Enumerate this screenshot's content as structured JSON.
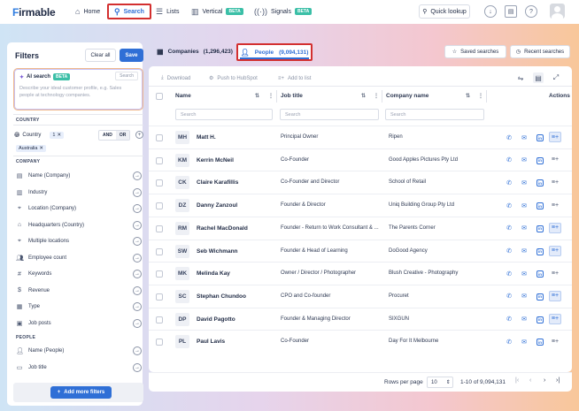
{
  "app": {
    "logo": "irmable",
    "logo_initial": "F"
  },
  "nav": {
    "home": "Home",
    "search": "Search",
    "lists": "Lists",
    "vertical": "Vertical",
    "vertical_badge": "BETA",
    "signals": "Signals",
    "signals_badge": "BETA",
    "quick_lookup": "Quick lookup"
  },
  "filters": {
    "title": "Filters",
    "clear_all": "Clear all",
    "save": "Save",
    "ai_search": {
      "label": "AI search",
      "badge": "BETA",
      "search_btn": "Search",
      "placeholder": "Describe your ideal customer profile, e.g. Sales people at technology companies."
    },
    "country_section": "COUNTRY",
    "country_label": "Country",
    "country_count": "1",
    "and": "AND",
    "or": "OR",
    "selected_country": "Australia",
    "company_section": "COMPANY",
    "company_items": [
      "Name (Company)",
      "Industry",
      "Location (Company)",
      "Headquarters (Country)",
      "Multiple locations",
      "Employee count",
      "Keywords",
      "Revenue",
      "Type",
      "Job posts"
    ],
    "people_section": "PEOPLE",
    "people_items": [
      "Name (People)",
      "Job title"
    ],
    "add_more": "Add more filters"
  },
  "tabs": {
    "companies": "Companies",
    "companies_count": "(1,296,423)",
    "people": "People",
    "people_count": "(9,094,131)",
    "saved_searches": "Saved searches",
    "recent_searches": "Recent searches"
  },
  "toolbar": {
    "download": "Download",
    "push_hubspot": "Push to HubSpot",
    "add_to_list": "Add to list"
  },
  "table": {
    "headers": {
      "name": "Name",
      "job_title": "Job title",
      "company": "Company name",
      "actions": "Actions"
    },
    "search_placeholder": "Search",
    "rows": [
      {
        "initials": "MH",
        "name": "Matt H.",
        "title": "Principal Owner",
        "company": "Ripen"
      },
      {
        "initials": "KM",
        "name": "Kerrin McNeil",
        "title": "Co-Founder",
        "company": "Good Apples Pictures Pty Ltd"
      },
      {
        "initials": "CK",
        "name": "Claire Karafillis",
        "title": "Co-Founder and Director",
        "company": "School of Retail"
      },
      {
        "initials": "DZ",
        "name": "Danny Zanzoul",
        "title": "Founder & Director",
        "company": "Uniq Building Group Pty Ltd"
      },
      {
        "initials": "RM",
        "name": "Rachel MacDonald",
        "title": "Founder - Return to Work Consultant & ...",
        "company": "The Parents Corner"
      },
      {
        "initials": "SW",
        "name": "Seb Wichmann",
        "title": "Founder & Head of Learning",
        "company": "DoGood Agency"
      },
      {
        "initials": "MK",
        "name": "Melinda Kay",
        "title": "Owner / Director / Photographer",
        "company": "Blush Creative - Photography"
      },
      {
        "initials": "SC",
        "name": "Stephan Chundoo",
        "title": "CPO and Co-founder",
        "company": "Procuret"
      },
      {
        "initials": "DP",
        "name": "David Pagotto",
        "title": "Founder & Managing Director",
        "company": "SIXGUN"
      },
      {
        "initials": "PL",
        "name": "Paul Lavis",
        "title": "Co-Founder",
        "company": "Day For It Melbourne"
      }
    ]
  },
  "pagination": {
    "rows_per_page_label": "Rows per page",
    "rows_per_page": "10",
    "range": "1-10 of 9,094,131"
  },
  "colors": {
    "accent": "#2f6fd6",
    "highlight": "#d32f2f",
    "badge": "#3bbfa7"
  }
}
